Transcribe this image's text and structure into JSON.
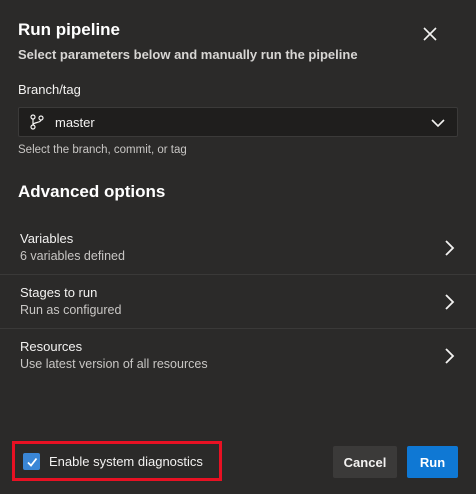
{
  "dialog": {
    "title": "Run pipeline",
    "subtitle": "Select parameters below and manually run the pipeline"
  },
  "branch": {
    "label": "Branch/tag",
    "value": "master",
    "help": "Select the branch, commit, or tag"
  },
  "advanced": {
    "title": "Advanced options",
    "items": [
      {
        "label": "Variables",
        "description": "6 variables defined"
      },
      {
        "label": "Stages to run",
        "description": "Run as configured"
      },
      {
        "label": "Resources",
        "description": "Use latest version of all resources"
      }
    ]
  },
  "footer": {
    "diagnostics_label": "Enable system diagnostics",
    "diagnostics_checked": true,
    "cancel_label": "Cancel",
    "run_label": "Run"
  },
  "colors": {
    "background": "#2b2a29",
    "primary": "#0f78d4",
    "checkbox": "#3a86d6",
    "highlight": "#e81123"
  },
  "icons": {
    "close": "close-icon",
    "branch": "branch-icon",
    "dropdown": "chevron-down-icon",
    "row_arrow": "chevron-right-icon",
    "checkbox": "checkmark-icon"
  }
}
